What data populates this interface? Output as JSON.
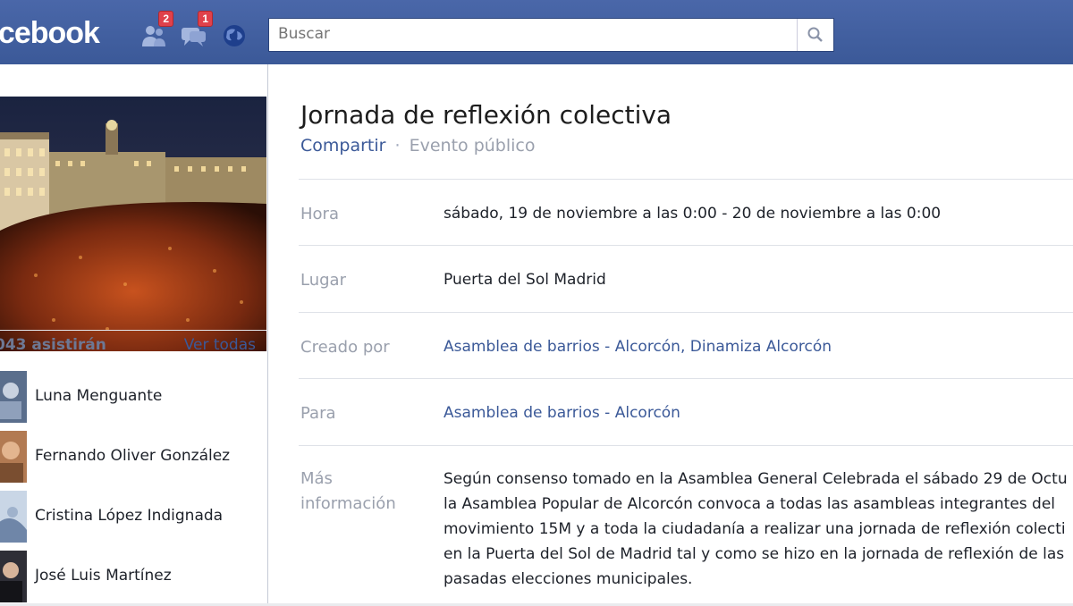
{
  "topbar": {
    "logo": "acebook",
    "friend_requests_count": "2",
    "messages_count": "1",
    "search_placeholder": "Buscar"
  },
  "left": {
    "attending_count": "043 asistirán",
    "see_all": "Ver todas",
    "attendees": [
      {
        "name": "Luna Menguante"
      },
      {
        "name": "Fernando Oliver González"
      },
      {
        "name": "Cristina López Indignada"
      },
      {
        "name": "José Luis Martínez"
      }
    ]
  },
  "event": {
    "title": "Jornada de reflexión colectiva",
    "share": "Compartir",
    "separator": "·",
    "kind": "Evento público",
    "rows": [
      {
        "label": "Hora",
        "value": "sábado, 19 de noviembre a las 0:00 - 20 de noviembre a las 0:00"
      },
      {
        "label": "Lugar",
        "value": "Puerta del Sol Madrid"
      },
      {
        "label": "Creado por",
        "value": "Asamblea de barrios - Alcorcón, Dinamiza Alcorcón"
      },
      {
        "label": "Para",
        "value": "Asamblea de barrios - Alcorcón"
      }
    ],
    "info_label_1": "Más",
    "info_label_2": "información",
    "info_lines": [
      "Según consenso tomado en la Asamblea General Celebrada el sábado 29 de Octu",
      "la Asamblea Popular de Alcorcón convoca a todas las asambleas integrantes del",
      "movimiento 15M y a toda la ciudadanía a realizar una jornada de reflexión colecti",
      "en la Puerta del Sol de Madrid tal y como se hizo en la jornada de reflexión de las",
      "pasadas elecciones municipales."
    ]
  },
  "colors": {
    "brand": "#3b5998",
    "badge": "#e0414b",
    "label_gray": "#9aa0ad"
  }
}
